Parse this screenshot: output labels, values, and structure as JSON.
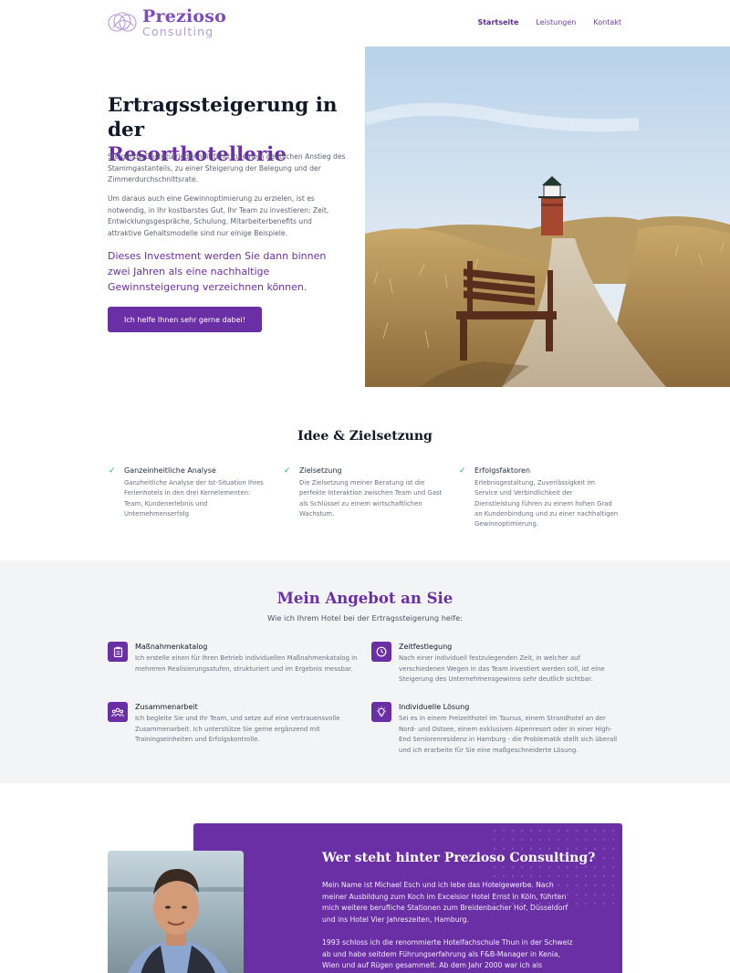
{
  "header": {
    "logo_name": "Prezioso",
    "logo_sub": "Consulting",
    "nav": [
      "Startseite",
      "Leistungen",
      "Kontakt"
    ]
  },
  "hero": {
    "title_line1": "Ertragssteigerung in der",
    "title_line2": "Resorthotellerie",
    "p1": "Steigende Gästezufriedenheit führt zu einem deutlichen Anstieg des Stammgastanteils, zu einer Steigerung der Belegung und der Zimmerdurchschnittsrate.",
    "p2": "Um daraus auch eine Gewinnoptimierung zu erzielen, ist es notwendig, in Ihr kostbarstes Gut, Ihr Team zu investieren: Zeit, Entwicklungsgespräche, Schulung, Mitarbeiterbenefits und attraktive Gehaltsmodelle sind nur einige Beispiele.",
    "lead": "Dieses Investment werden Sie dann binnen zwei Jahren als eine nachhaltige Gewinnsteigerung verzeichnen können.",
    "button": "Ich helfe Ihnen sehr gerne dabei!"
  },
  "idee": {
    "title": "Idee & Zielsetzung",
    "items": [
      {
        "title": "Ganzeinheitliche Analyse",
        "text": "Ganzheitliche Analyse der Ist-Situation Ihres Ferienhotels in den drei Kernelementen: Team, Kundenerlebnis und Unternehmenserfolg"
      },
      {
        "title": "Zielsetzung",
        "text": "Die Zielsetzung meiner Beratung ist die perfekte Interaktion zwischen Team und Gast als Schlüssel zu einem wirtschaftlichen Wachstum."
      },
      {
        "title": "Erfolgsfaktoren",
        "text": "Erlebnisgestaltung, Zuverlässigkeit im Service und Verbindlichkeit der Dienstleistung führen zu einem hohen Grad an Kundenbindung und zu einer nachhaltigen Gewinnoptimierung."
      }
    ]
  },
  "angebot": {
    "title": "Mein Angebot an Sie",
    "subtitle": "Wie ich Ihrem Hotel bei der Ertragssteigerung helfe:",
    "items": [
      {
        "title": "Maßnahmenkatalog",
        "text": "Ich erstelle einen für Ihren Betrieb individuellen Maßnahmenkatalog in mehreren Realisierungsstufen, strukturiert und im Ergebnis messbar.",
        "icon": "clipboard-icon"
      },
      {
        "title": "Zeitfestlegung",
        "text": "Nach einer individuell festzulegenden Zeit, in welcher auf verschiedenen Wegen in das Team investiert werden soll, ist eine Steigerung des Unternehmensgewinns sehr deutlich sichtbar.",
        "icon": "clock-icon"
      },
      {
        "title": "Zusammenarbeit",
        "text": "Ich begleite Sie und Ihr Team, und setze auf eine vertrauensvolle Zusammenarbeit. Ich unterstütze Sie gerne ergänzend mit Trainingseinheiten und Erfolgskontrolle.",
        "icon": "team-icon"
      },
      {
        "title": "Individuelle Lösung",
        "text": "Sei es in einem Freizeithotel im Taunus, einem Strandhotel an der Nord- und Ostsee, einem exklusiven Alpenresort oder in einer High-End Seniorenresidenz in Hamburg - die Problematik stellt sich überall und ich erarbeite für Sie eine maßgeschneiderte Lösung.",
        "icon": "lightbulb-icon"
      }
    ]
  },
  "about": {
    "title": "Wer steht hinter Prezioso Consulting?",
    "p1": "Mein Name ist Michael Esch und ich lebe das Hotelgewerbe. Nach meiner Ausbildung zum Koch im Excelsior Hotel Ernst in Köln, führten mich weitere berufliche Stationen zum Breidenbacher Hof, Düsseldorf und ins Hotel Vier Jahreszeiten, Hamburg.",
    "p2": "1993 schloss ich die renommierte Hotelfachschule Thun in der Schweiz ab und habe seitdem Führungserfahrung als F&B-Manager in Kenia, Wien und auf Rügen gesammelt. Ab dem Jahr 2000 war ich als"
  },
  "colors": {
    "brand": "#6b2fa5",
    "check": "#22b07d",
    "section_gray": "#f3f4f6"
  }
}
